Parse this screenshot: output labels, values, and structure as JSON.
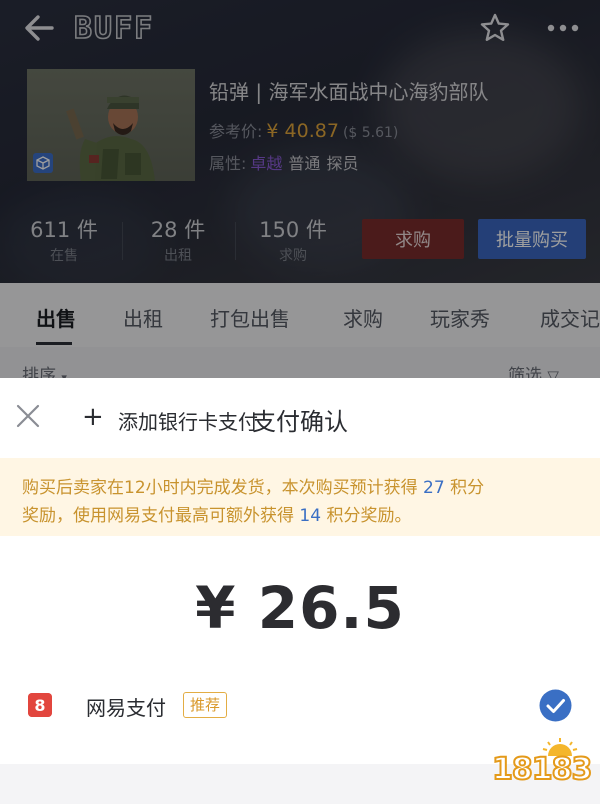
{
  "header": {
    "logo": "BUFF",
    "back_icon": "arrow-left-icon",
    "favorite_icon": "star-outline-icon",
    "more_icon": "more-dots-icon"
  },
  "item": {
    "name": "铅弹 | 海军水面战中心海豹部队",
    "ref_label": "参考价:",
    "ref_price": "¥ 40.87",
    "ref_usd": "($ 5.61)",
    "attr_label": "属性:",
    "rarity": "卓越",
    "tags": [
      "普通",
      "探员"
    ],
    "thumb_badge_icon": "cube-icon"
  },
  "stats": [
    {
      "count": "611 件",
      "label": "在售"
    },
    {
      "count": "28 件",
      "label": "出租"
    },
    {
      "count": "150 件",
      "label": "求购"
    }
  ],
  "actions": {
    "buy_request": "求购",
    "bulk_buy": "批量购买"
  },
  "tabs": [
    "出售",
    "出租",
    "打包出售",
    "求购",
    "玩家秀",
    "成交记"
  ],
  "list_controls": {
    "sort": "排序",
    "filter": "筛选"
  },
  "sheet": {
    "title": "支付确认",
    "notice_line1_pre": "购买后卖家在12小时内完成发货，本次购买预计获得",
    "points_earned": "27",
    "notice_line1_post": "积分",
    "notice_line2_pre": "奖励，使用网易支付最高可额外获得",
    "points_extra": "14",
    "notice_line2_post": "积分奖励。",
    "amount": "¥ 26.5",
    "payment_method": "网易支付",
    "recommended_badge": "推荐",
    "add_card": "添加银行卡支付"
  },
  "colors": {
    "accent_blue": "#3a67c0",
    "buy_red": "#7a2c2c",
    "price_gold": "#e0a53a",
    "rarity_purple": "#8a5bd6",
    "notice_bg": "#fff6e4",
    "notice_text": "#c8932e",
    "check_blue": "#3a6fc4"
  },
  "watermark": "18183"
}
